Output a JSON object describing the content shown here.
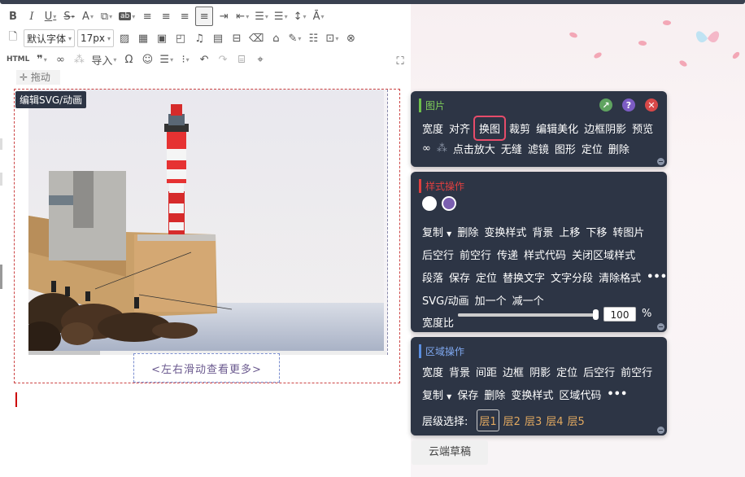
{
  "toolbar": {
    "row1": [
      "B",
      "I",
      "U",
      "S",
      "A",
      "copy",
      "ab",
      "align-left",
      "align-center",
      "align-right",
      "align-justify",
      "indent",
      "outdent",
      "spacing",
      "line-height",
      "line-height2",
      "A-style"
    ],
    "font_family": "默认字体",
    "font_size": "17px",
    "import_label": "导入",
    "html_label": "HTML"
  },
  "editor": {
    "drag_label": "拖动",
    "svg_badge": "编辑SVG/动画",
    "more_hint": "<左右滑动查看更多>"
  },
  "image_panel": {
    "title": "图片",
    "row1": [
      "宽度",
      "对齐",
      "换图",
      "裁剪",
      "编辑美化",
      "边框阴影",
      "预览"
    ],
    "row2": [
      "点击放大",
      "无缝",
      "滤镜",
      "图形",
      "定位",
      "删除"
    ],
    "highlighted": "换图"
  },
  "style_panel": {
    "title": "样式操作",
    "copy_label": "复制",
    "row1": [
      "删除",
      "变换样式",
      "背景",
      "上移",
      "下移",
      "转图片"
    ],
    "row2": [
      "后空行",
      "前空行",
      "传递",
      "样式代码",
      "关闭区域样式"
    ],
    "row3": [
      "段落",
      "保存",
      "定位",
      "替换文字",
      "文字分段",
      "清除格式"
    ],
    "row4": [
      "SVG/动画",
      "加一个",
      "减一个"
    ],
    "width_ratio_label": "宽度比",
    "width_ratio_value": "100",
    "percent_sign": "%",
    "more": "•••"
  },
  "area_panel": {
    "title": "区域操作",
    "row1": [
      "宽度",
      "背景",
      "间距",
      "边框",
      "阴影",
      "定位",
      "后空行",
      "前空行"
    ],
    "copy_label": "复制",
    "row2": [
      "保存",
      "删除",
      "变换样式",
      "区域代码"
    ],
    "more": "•••",
    "level_label": "层级选择:",
    "levels": [
      "层1",
      "层2",
      "层3",
      "层4",
      "层5"
    ]
  },
  "cloud_drafts": "云端草稿",
  "colors": {
    "panel_bg": "#2d3545",
    "image_title_bar": "#6dbf4b",
    "style_title_bar": "#e04040",
    "area_title_bar": "#5a8ee0",
    "highlight": "#e74c6a"
  }
}
